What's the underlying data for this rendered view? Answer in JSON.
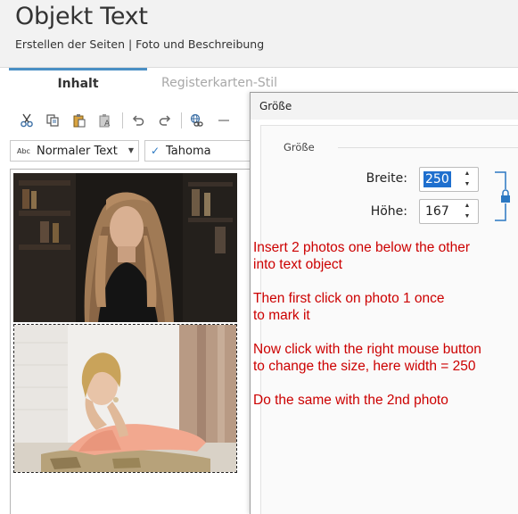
{
  "header": {
    "title": "Objekt Text",
    "subtitle": "Erstellen der Seiten | Foto und Beschreibung"
  },
  "tabs": [
    {
      "label": "Inhalt",
      "active": true
    },
    {
      "label": "Registerkarten-Stil",
      "active": false
    }
  ],
  "toolbar": {
    "buttons": [
      "cut-icon",
      "copy-icon",
      "paste-icon",
      "paste-text-icon",
      "undo-icon",
      "redo-icon",
      "link-icon",
      "horizontal-line-icon"
    ]
  },
  "format": {
    "style_prefix": "Abc",
    "style_value": "Normaler Text",
    "font_value": "Tahoma"
  },
  "dialog": {
    "title": "Größe",
    "group_label": "Größe",
    "width_label": "Breite:",
    "width_value": "250",
    "height_label": "Höhe:",
    "height_value": "167"
  },
  "annotations": [
    [
      "Insert 2 photos one below the other",
      "into text object"
    ],
    [
      "Then first click on photo 1 once",
      "to mark it"
    ],
    [
      "Now click with the right mouse button",
      "to change the size, here width = 250"
    ],
    [
      "Do the same with the 2nd photo"
    ]
  ],
  "colors": {
    "accent": "#4a8fc4",
    "annotation": "#cc0000",
    "selection": "#1f6fce"
  }
}
